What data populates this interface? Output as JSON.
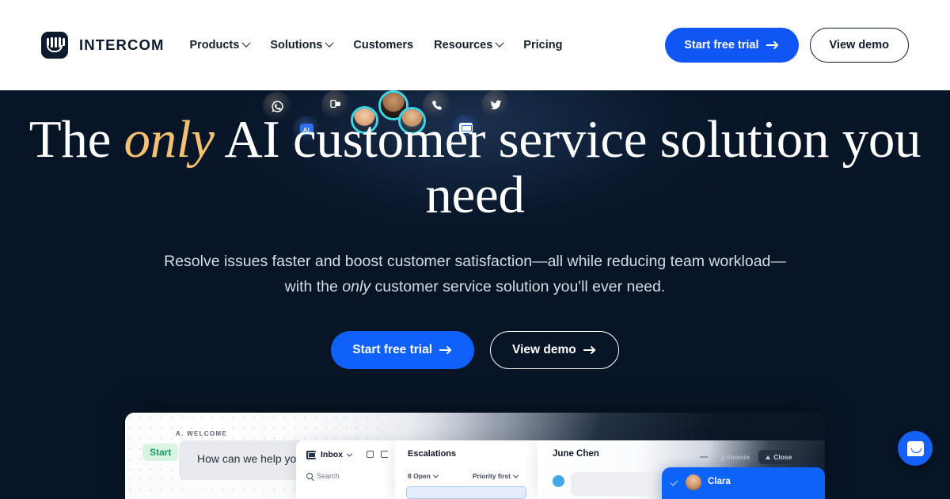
{
  "header": {
    "brand": {
      "name": "INTERCOM",
      "logo_icon": "intercom-logo-icon"
    },
    "nav": [
      {
        "label": "Products",
        "has_caret": true
      },
      {
        "label": "Solutions",
        "has_caret": true
      },
      {
        "label": "Customers",
        "has_caret": false
      },
      {
        "label": "Resources",
        "has_caret": true
      },
      {
        "label": "Pricing",
        "has_caret": false
      }
    ],
    "cta_primary": "Start free trial",
    "cta_secondary": "View demo"
  },
  "hero": {
    "headline_part1": "The ",
    "headline_emphasis": "only",
    "headline_part2": " AI customer service solution you need",
    "subheadline_line1": "Resolve issues faster and boost customer satisfaction—all while reducing team workload—",
    "subheadline_line2_a": "with the ",
    "subheadline_line2_em": "only",
    "subheadline_line2_b": " customer service solution you'll ever need.",
    "cta_primary": "Start free trial",
    "cta_secondary": "View demo",
    "channel_icons": [
      {
        "name": "whatsapp-icon",
        "style": "dim"
      },
      {
        "name": "ai-badge-icon",
        "label": "AI",
        "style": "blueglow"
      },
      {
        "name": "messenger-icon",
        "style": "dim"
      },
      {
        "name": "phone-icon",
        "style": "dim"
      },
      {
        "name": "email-icon",
        "style": "blueglow"
      },
      {
        "name": "twitter-icon",
        "style": "dim"
      }
    ],
    "avatars": [
      "agent-avatar-1",
      "agent-avatar-2",
      "agent-avatar-3"
    ]
  },
  "colors": {
    "hero_background": "#081527",
    "accent_blue": "#1060fb",
    "headline_gold": "#f3c173",
    "avatar_ring": "#3dd6e8",
    "header_background": "#ffffff"
  },
  "product_shot": {
    "welcome_label": "A. WELCOME",
    "start_chip": "Start",
    "welcome_message": "How can we help you today?",
    "inbox_title": "Inbox",
    "search_placeholder": "Search",
    "list_title": "Escalations",
    "filter_open": "8 Open",
    "filter_sort": "Priority first",
    "conversation_name": "June Chen",
    "snooze_label": "Snooze",
    "close_label": "Close",
    "clara_name": "Clara"
  },
  "messenger": {
    "launcher_icon": "intercom-messenger-icon"
  }
}
